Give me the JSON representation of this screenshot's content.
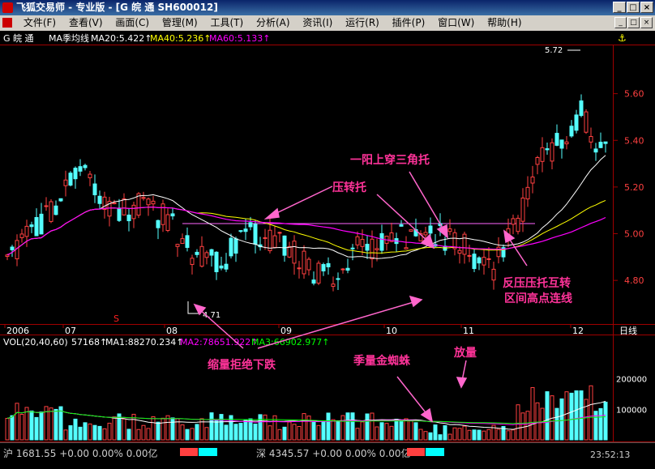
{
  "window": {
    "title": "飞狐交易师 - 专业版 - [G 皖  通 SH600012]"
  },
  "menu": [
    "文件(F)",
    "查看(V)",
    "画面(C)",
    "管理(M)",
    "工具(T)",
    "分析(A)",
    "资讯(I)",
    "运行(R)",
    "插件(P)",
    "窗口(W)",
    "帮助(H)"
  ],
  "indicator_header": {
    "stock": "G 皖  通",
    "name": "MA季均线",
    "ma20": "MA20:5.422↑",
    "ma40": "MA40:5.236↑",
    "ma60": "MA60:5.133↑"
  },
  "vol_header": {
    "name": "VOL(20,40,60)",
    "vol": "57168↑",
    "ma1": "MA1:88270.234↑",
    "ma2": "MA2:78651.922↑",
    "ma3": "MA3:66902.977↑"
  },
  "colors": {
    "up": "#ff4040",
    "down": "#54ffff",
    "ma20": "#ffffff",
    "ma40": "#ffff00",
    "ma60": "#ff00ff",
    "annotation": "#ff3399",
    "axis": "#a00000"
  },
  "annotations": {
    "a1": "一阳上穿三角托",
    "a2": "压转托",
    "a3": "反压压托互转",
    "a3b": "区间高点连线",
    "a4": "缩量拒绝下跌",
    "a5": "季量金蜘蛛",
    "a6": "放量"
  },
  "period_label": "日线",
  "high_label": "5.72",
  "low_label": "4.71",
  "marker": "S",
  "chart_data": [
    {
      "type": "candlestick",
      "x_labels": [
        "2006",
        "07",
        "08",
        "09",
        "10",
        "11",
        "12"
      ],
      "y_ticks": [
        5.6,
        5.4,
        5.2,
        5.0,
        4.8
      ],
      "ylim": [
        4.62,
        5.8
      ],
      "high": 5.72,
      "low": 4.71,
      "series": [
        {
          "name": "MA20",
          "last": 5.422
        },
        {
          "name": "MA40",
          "last": 5.236
        },
        {
          "name": "MA60",
          "last": 5.133
        }
      ]
    },
    {
      "type": "bar",
      "y_ticks": [
        200000,
        100000
      ],
      "ylim": [
        0,
        300000
      ],
      "series": [
        {
          "name": "VOL",
          "last": 57168
        },
        {
          "name": "MA1",
          "last": 88270.234
        },
        {
          "name": "MA2",
          "last": 78651.922
        },
        {
          "name": "MA3",
          "last": 66902.977
        }
      ]
    }
  ],
  "status": {
    "sh": "沪 1681.55 +0.00 0.00% 0.00亿",
    "sz": "深 4345.57 +0.00 0.00% 0.00亿",
    "time": "23:52:13"
  }
}
